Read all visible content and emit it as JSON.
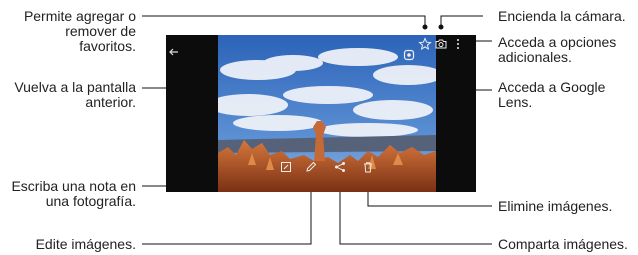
{
  "callouts": {
    "favorites": "Permite agregar o remover de favoritos.",
    "back": "Vuelva a la pantalla anterior.",
    "note": "Escriba una nota en una fotografía.",
    "edit": "Edite imágenes.",
    "camera": "Encienda la cámara.",
    "more_options": "Acceda a opciones adicionales.",
    "lens": "Acceda a Google Lens.",
    "delete": "Elimine imágenes.",
    "share": "Comparta imágenes."
  },
  "icons": {
    "back": "arrow-left-icon",
    "lens": "google-lens-icon",
    "favorite": "star-icon",
    "camera": "camera-icon",
    "more": "more-vertical-icon",
    "note": "note-icon",
    "edit": "pencil-icon",
    "share": "share-icon",
    "delete": "trash-icon"
  },
  "colors": {
    "leader_lines": "#111111",
    "screen_background": "#0c0c0c",
    "sky_top": "#2c63b8",
    "sky_bottom": "#8fb8e6",
    "rock": "#b4552a"
  }
}
